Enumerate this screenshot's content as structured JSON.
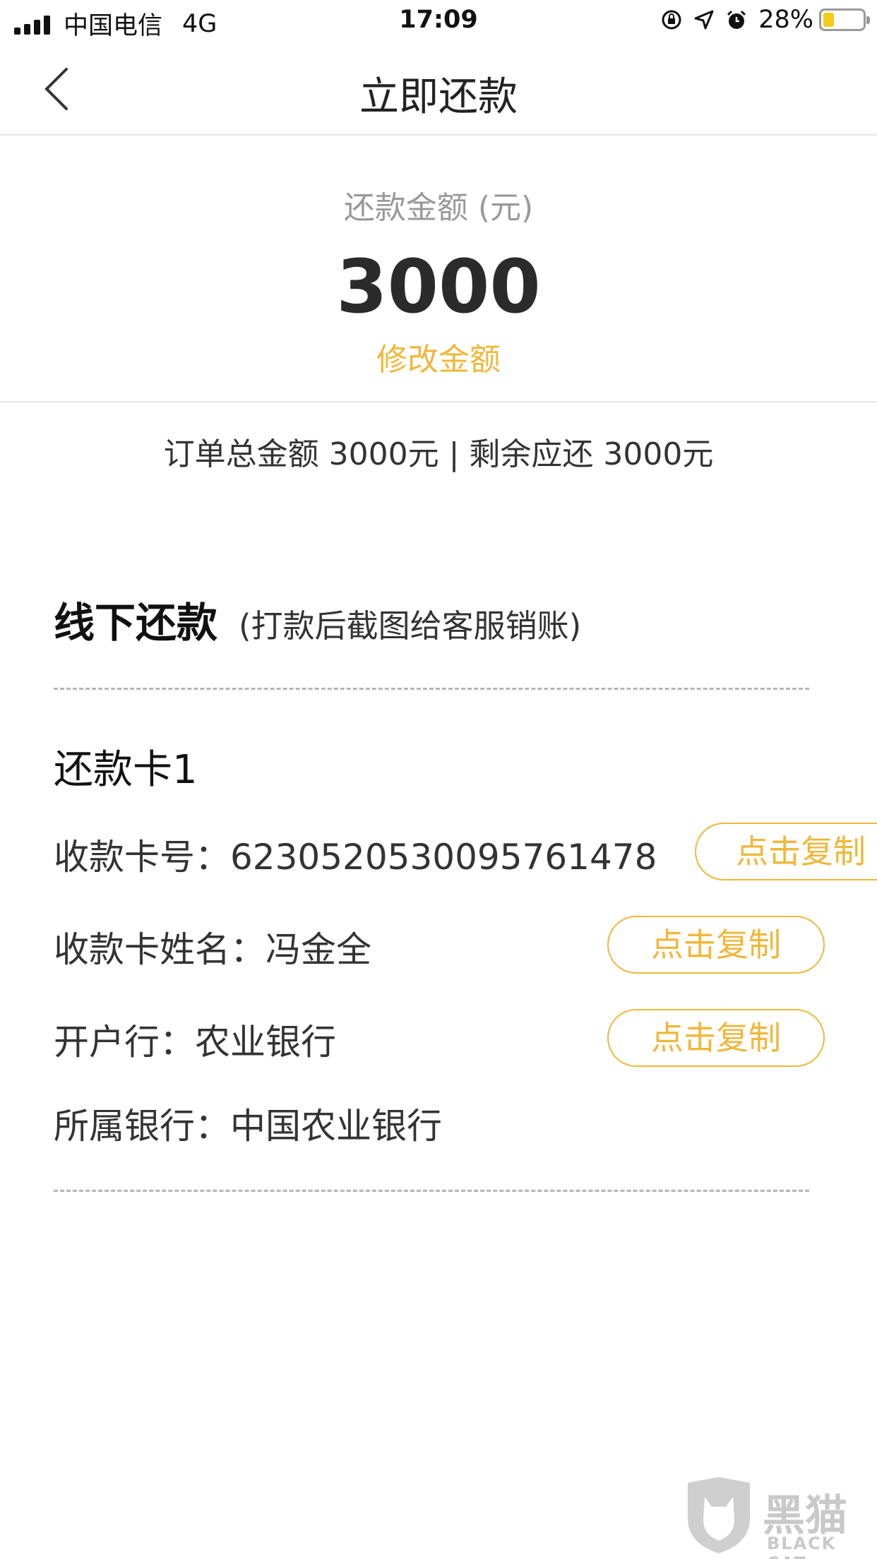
{
  "status_bar": {
    "carrier": "中国电信",
    "network": "4G",
    "time": "17:09",
    "battery_percent": "28%",
    "battery_level": 0.28,
    "battery_color": "#f5cc1a"
  },
  "nav": {
    "back_icon": "chevron-left-icon",
    "title": "立即还款"
  },
  "amount": {
    "label": "还款金额 (元)",
    "value": "3000",
    "edit_label": "修改金额"
  },
  "summary": "订单总金额 3000元 | 剩余应还 3000元",
  "offline": {
    "title": "线下还款",
    "note": "(打款后截图给客服销账)"
  },
  "card": {
    "title": "还款卡1",
    "account_number_label": "收款卡号：",
    "account_number": "6230520530095761478",
    "account_name_label": "收款卡姓名：",
    "account_name": "冯金全",
    "branch_label": "开户行：",
    "branch": "农业银行",
    "bank_label": "所属银行：",
    "bank": "中国农业银行",
    "copy_label": "点击复制"
  },
  "watermark": {
    "text": "黑猫",
    "sub": "BLACK CAT"
  },
  "colors": {
    "accent": "#f0b73a",
    "muted": "#999999"
  }
}
